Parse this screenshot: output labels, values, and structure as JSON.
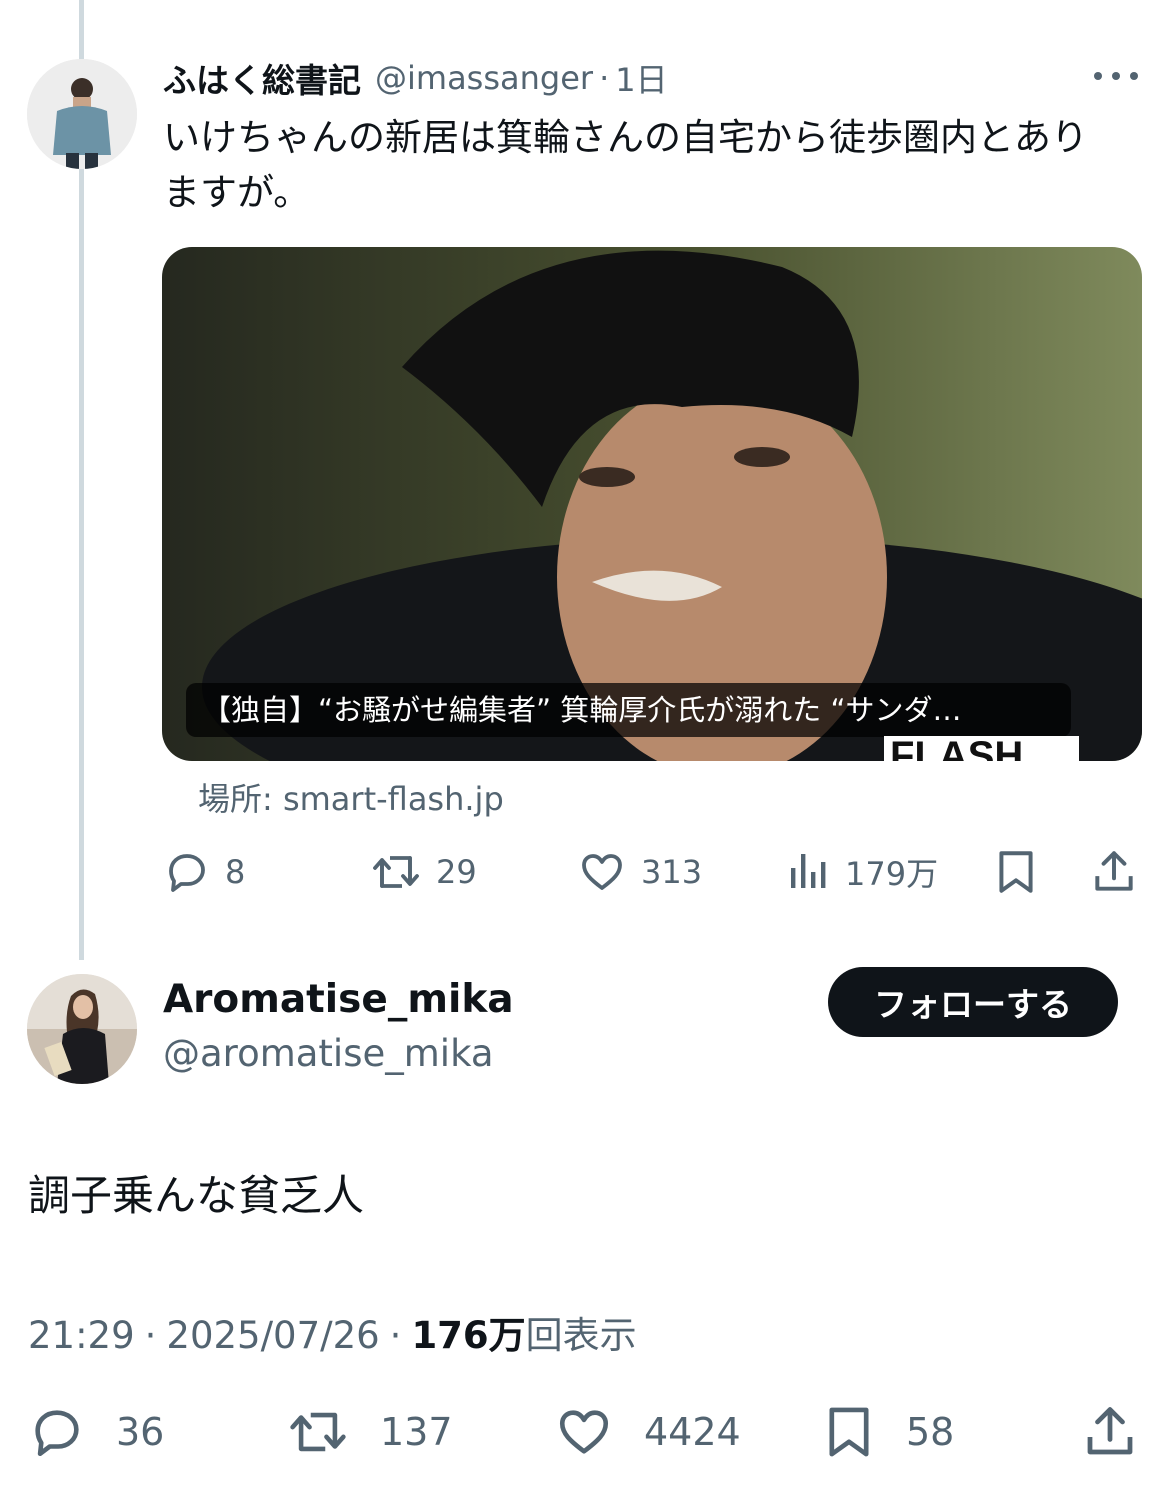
{
  "parent_tweet": {
    "author_name": "ふはく総書記",
    "handle": "@imassanger",
    "time": "1日",
    "text": "いけちゃんの新居は箕輪さんの自宅から徒歩圏内とありますが。",
    "card": {
      "caption": "【独自】“お騒がせ編集者” 箕輪厚介氏が溺れた “サンダ…",
      "logo_text": "FLASH",
      "source": "場所: smart-flash.jp"
    },
    "actions": {
      "replies": "8",
      "reposts": "29",
      "likes": "313",
      "views": "179万"
    }
  },
  "main_tweet": {
    "author_name": "Aromatise_mika",
    "handle": "@aromatise_mika",
    "follow_label": "フォローする",
    "text": "調子乗んな貧乏人",
    "time": "21:29",
    "date": "2025/07/26",
    "views_count": "176万",
    "views_suffix": "回表示",
    "actions": {
      "replies": "36",
      "reposts": "137",
      "likes": "4424",
      "bookmarks": "58"
    }
  },
  "colors": {
    "text_primary": "#0f1419",
    "text_secondary": "#536471",
    "thread_line": "#cfd9de",
    "button_bg": "#0f1419"
  }
}
